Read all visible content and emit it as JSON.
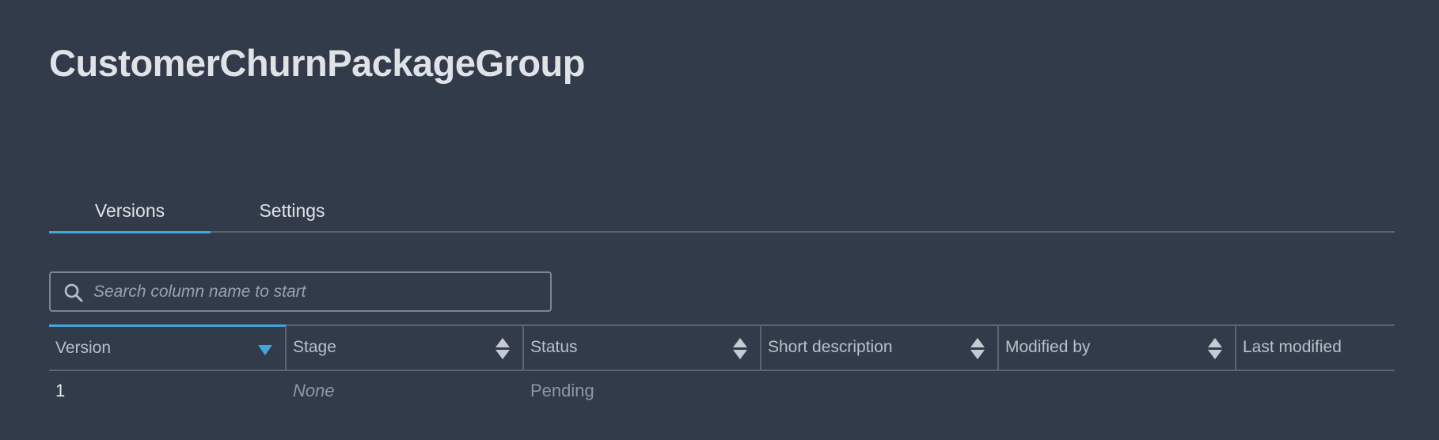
{
  "page": {
    "title": "CustomerChurnPackageGroup"
  },
  "tabs": [
    {
      "label": "Versions",
      "active": true
    },
    {
      "label": "Settings",
      "active": false
    }
  ],
  "search": {
    "placeholder": "Search column name to start",
    "value": "",
    "icon": "search-icon"
  },
  "table": {
    "columns": [
      {
        "label": "Version",
        "sort": "descending"
      },
      {
        "label": "Stage",
        "sort": "none"
      },
      {
        "label": "Status",
        "sort": "none"
      },
      {
        "label": "Short description",
        "sort": "none"
      },
      {
        "label": "Modified by",
        "sort": "none"
      },
      {
        "label": "Last modified",
        "sort": "none"
      }
    ],
    "rows": [
      {
        "version": "1",
        "stage": "None",
        "status": "Pending",
        "short_description": "",
        "modified_by": "",
        "last_modified": ""
      }
    ]
  },
  "colors": {
    "background": "#323b4a",
    "accent": "#44a5d8",
    "divider": "#5b6472",
    "text": "#dfe3e8",
    "muted_text": "#8e97a2"
  }
}
